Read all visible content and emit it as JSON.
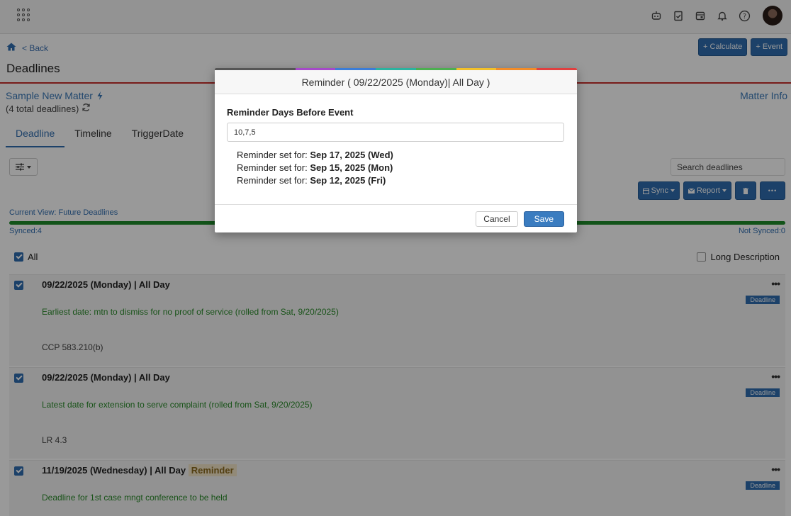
{
  "topbar": {
    "icons": [
      "apps-grid-icon",
      "robot-icon",
      "clipboard-check-icon",
      "calendar-icon",
      "bell-icon",
      "help-icon",
      "avatar"
    ]
  },
  "header": {
    "back_label": "< Back",
    "title": "Deadlines",
    "calculate_label": "+ Calculate",
    "event_label": "+ Event"
  },
  "matter": {
    "name": "Sample New Matter",
    "count_text": "(4 total deadlines)",
    "info_label": "Matter Info"
  },
  "tabs": [
    {
      "label": "Deadline",
      "active": true
    },
    {
      "label": "Timeline",
      "active": false
    },
    {
      "label": "TriggerDate",
      "active": false
    }
  ],
  "toolbar": {
    "search_placeholder": "Search deadlines",
    "sync_label": "Sync",
    "report_label": "Report",
    "more_label": "•••"
  },
  "sync_status": {
    "current_view": "Current View: Future Deadlines",
    "synced": "Synced:4",
    "not_synced": "Not Synced:0",
    "progress": 1.0
  },
  "list": {
    "all_label": "All",
    "long_description_label": "Long Description",
    "items": [
      {
        "date": "09/22/2025 (Monday) | All Day",
        "reminder": "",
        "badge": "Deadline",
        "description": "Earliest date: mtn to dismiss for no proof of service (rolled from Sat, 9/20/2025)",
        "reference": "CCP 583.210(b)"
      },
      {
        "date": "09/22/2025 (Monday) | All Day",
        "reminder": "",
        "badge": "Deadline",
        "description": "Latest date for extension to serve complaint (rolled from Sat, 9/20/2025)",
        "reference": "LR 4.3"
      },
      {
        "date": "11/19/2025 (Wednesday) | All Day",
        "reminder": "Reminder",
        "badge": "Deadline",
        "description": "Deadline for 1st case mngt conference to be held",
        "reference": ""
      }
    ]
  },
  "modal": {
    "title": "Reminder ( 09/22/2025 (Monday)| All Day )",
    "label": "Reminder Days Before Event",
    "input_value": "10,7,5",
    "line_prefix": "Reminder set for: ",
    "dates": [
      "Sep 17, 2025 (Wed)",
      "Sep 15, 2025 (Mon)",
      "Sep 12, 2025 (Fri)"
    ],
    "cancel_label": "Cancel",
    "save_label": "Save",
    "rainbow_colors": [
      "#555555",
      "#555555",
      "#a64ac9",
      "#3b7dd8",
      "#2bb3a0",
      "#4caf50",
      "#f2c029",
      "#f28c28",
      "#e04040"
    ]
  },
  "colors": {
    "accent": "#2f6db0",
    "green_text": "#2a8a2a",
    "rule_red": "#c9302c"
  }
}
